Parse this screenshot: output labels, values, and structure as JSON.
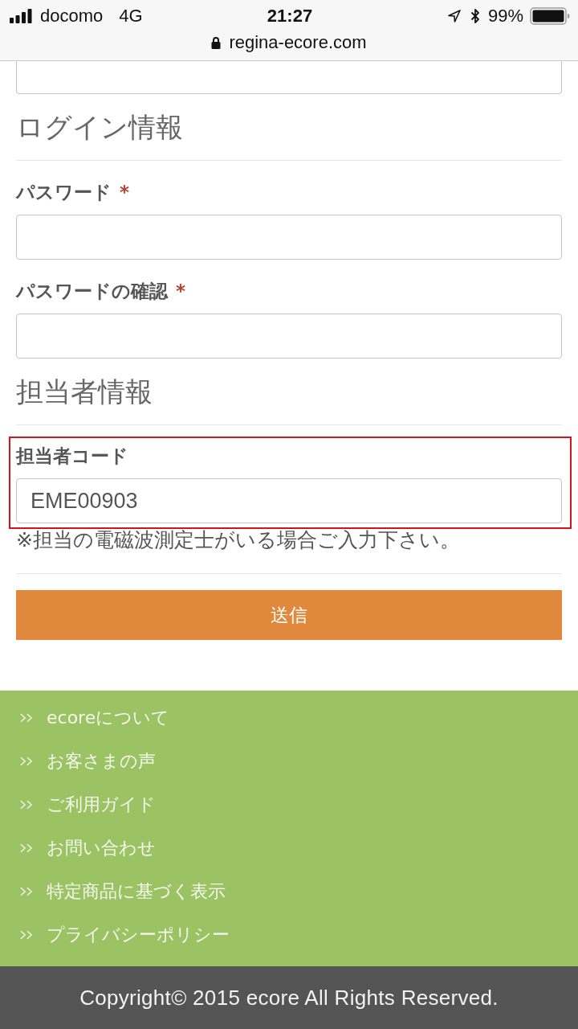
{
  "status_bar": {
    "carrier": "docomo",
    "network": "4G",
    "time": "21:27",
    "battery": "99%"
  },
  "address_bar": {
    "url": "regina-ecore.com"
  },
  "sections": [
    {
      "title": "ログイン情報",
      "fields": [
        {
          "label": "パスワード",
          "required_mark": "*",
          "highlighted": false
        },
        {
          "label": "パスワードの確認",
          "required_mark": "*",
          "highlighted": false
        }
      ]
    },
    {
      "title": "担当者情報",
      "fields": [
        {
          "label": "担当者コード",
          "value": "EME00903",
          "highlighted": true,
          "note": "※担当の電磁波測定士がいる場合ご入力下さい。"
        }
      ]
    }
  ],
  "submit_button": "送信",
  "footer_links": [
    "ecoreについて",
    "お客さまの声",
    "ご利用ガイド",
    "お問い合わせ",
    "特定商品に基づく表示",
    "プライバシーポリシー"
  ],
  "copyright": "Copyright© 2015 ecore All Rights Reserved."
}
